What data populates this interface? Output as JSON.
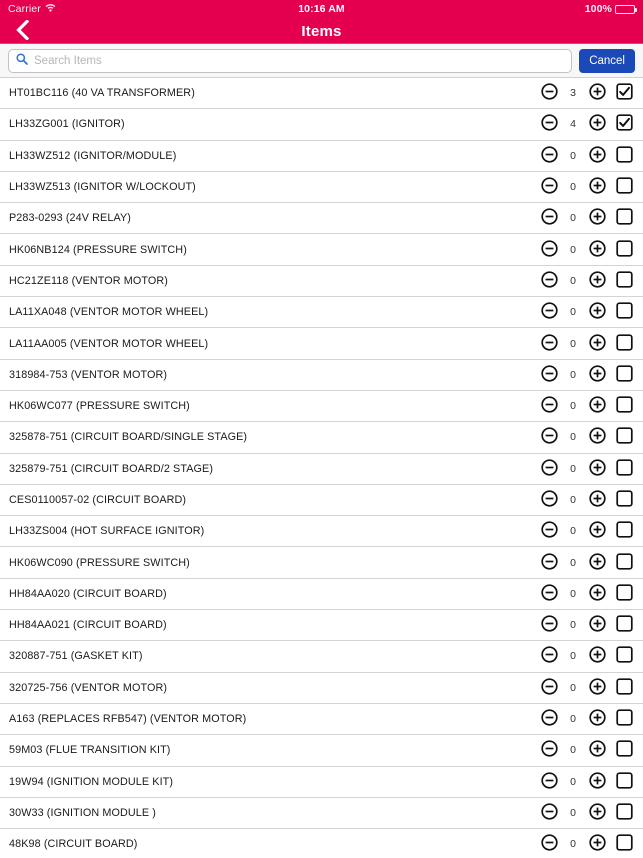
{
  "status_bar": {
    "carrier": "Carrier",
    "wifi_icon": "wifi-icon",
    "time": "10:16 AM",
    "battery_percent": "100%",
    "battery_icon": "battery-full-icon"
  },
  "nav": {
    "back_icon": "chevron-left-icon",
    "title": "Items"
  },
  "search": {
    "icon": "search-icon",
    "placeholder": "Search Items",
    "value": "",
    "cancel_label": "Cancel"
  },
  "colors": {
    "brand_pink": "#e4004f",
    "accent_blue": "#1c49b8",
    "separator": "#d4d4d4",
    "search_bg": "#f7f7f7"
  },
  "icons": {
    "minus": "minus-circle-icon",
    "plus": "plus-circle-icon",
    "checkbox_checked": "checkbox-checked-icon",
    "checkbox_unchecked": "checkbox-unchecked-icon"
  },
  "items": [
    {
      "label": "HT01BC116 (40 VA TRANSFORMER)",
      "qty": "3",
      "checked": true
    },
    {
      "label": "LH33ZG001 (IGNITOR)",
      "qty": "4",
      "checked": true
    },
    {
      "label": "LH33WZ512 (IGNITOR/MODULE)",
      "qty": "0",
      "checked": false
    },
    {
      "label": "LH33WZ513 (IGNITOR W/LOCKOUT)",
      "qty": "0",
      "checked": false
    },
    {
      "label": "P283-0293 (24V RELAY)",
      "qty": "0",
      "checked": false
    },
    {
      "label": "HK06NB124 (PRESSURE SWITCH)",
      "qty": "0",
      "checked": false
    },
    {
      "label": "HC21ZE118 (VENTOR MOTOR)",
      "qty": "0",
      "checked": false
    },
    {
      "label": "LA11XA048 (VENTOR MOTOR WHEEL)",
      "qty": "0",
      "checked": false
    },
    {
      "label": "LA11AA005 (VENTOR MOTOR WHEEL)",
      "qty": "0",
      "checked": false
    },
    {
      "label": "318984-753 (VENTOR MOTOR)",
      "qty": "0",
      "checked": false
    },
    {
      "label": "HK06WC077 (PRESSURE SWITCH)",
      "qty": "0",
      "checked": false
    },
    {
      "label": "325878-751 (CIRCUIT BOARD/SINGLE STAGE)",
      "qty": "0",
      "checked": false
    },
    {
      "label": "325879-751 (CIRCUIT BOARD/2 STAGE)",
      "qty": "0",
      "checked": false
    },
    {
      "label": "CES0110057-02 (CIRCUIT BOARD)",
      "qty": "0",
      "checked": false
    },
    {
      "label": "LH33ZS004 (HOT SURFACE IGNITOR)",
      "qty": "0",
      "checked": false
    },
    {
      "label": "HK06WC090 (PRESSURE SWITCH)",
      "qty": "0",
      "checked": false
    },
    {
      "label": "HH84AA020 (CIRCUIT BOARD)",
      "qty": "0",
      "checked": false
    },
    {
      "label": "HH84AA021 (CIRCUIT BOARD)",
      "qty": "0",
      "checked": false
    },
    {
      "label": "320887-751 (GASKET KIT)",
      "qty": "0",
      "checked": false
    },
    {
      "label": "320725-756 (VENTOR MOTOR)",
      "qty": "0",
      "checked": false
    },
    {
      "label": "A163 (REPLACES RFB547) (VENTOR MOTOR)",
      "qty": "0",
      "checked": false
    },
    {
      "label": "59M03 (FLUE TRANSITION KIT)",
      "qty": "0",
      "checked": false
    },
    {
      "label": "19W94 (IGNITION MODULE KIT)",
      "qty": "0",
      "checked": false
    },
    {
      "label": "30W33 (IGNITION MODULE )",
      "qty": "0",
      "checked": false
    },
    {
      "label": "48K98 (CIRCUIT BOARD)",
      "qty": "0",
      "checked": false
    }
  ]
}
